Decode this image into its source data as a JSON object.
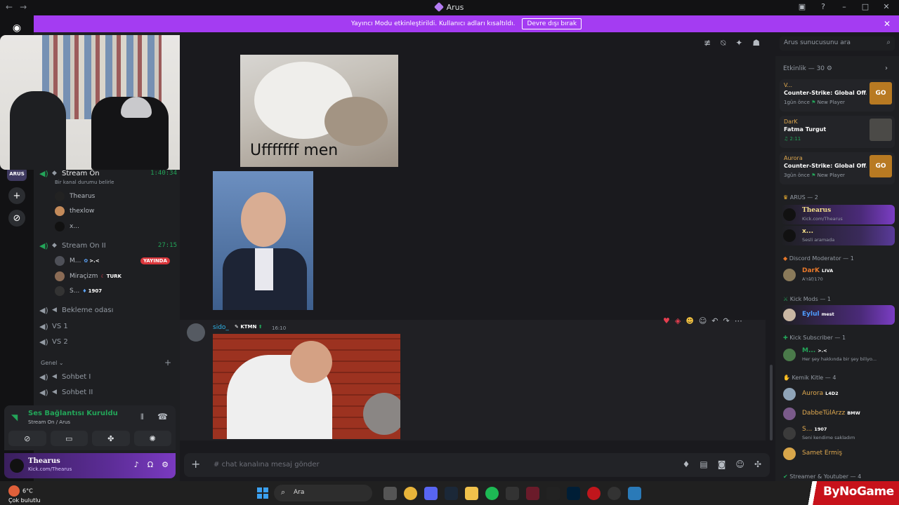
{
  "window": {
    "title": "Arus",
    "nav_back": "←",
    "nav_forward": "→"
  },
  "banner": {
    "text": "Yayıncı Modu etkinleştirildi. Kullanıcı adları kısaltıldı.",
    "button": "Devre dışı bırak",
    "close": "✕"
  },
  "guilds": {
    "arus_label": "ARUS",
    "add": "+",
    "explore": "⊘"
  },
  "channels": {
    "stream_on": {
      "name": "Stream On",
      "time": "1:40:34",
      "status": "Bir kanal durumu belirle"
    },
    "stream_on_members": [
      {
        "name": "Thearus",
        "tag": ""
      },
      {
        "name": "thexlow",
        "tag": ""
      },
      {
        "name": "x...",
        "tag": ""
      }
    ],
    "stream_on_ii": {
      "name": "Stream On II",
      "time": "27:15"
    },
    "stream_on_ii_members": [
      {
        "name": "M...",
        "tag": ">.<",
        "badge": "YAYINDA"
      },
      {
        "name": "Miraçizm",
        "tag": "TURK"
      },
      {
        "name": "S...",
        "tag": "1907"
      }
    ],
    "bekleme": "Bekleme odası",
    "vs1": "VS 1",
    "vs2": "VS 2",
    "category_genel": "Genel",
    "sohbet1": "Sohbet I",
    "sohbet2": "Sohbet II"
  },
  "voice_panel": {
    "status": "Ses Bağlantısı Kuruldu",
    "location": "Stream On / Arus"
  },
  "user_panel": {
    "name": "Thearus",
    "status": "Kick.com/Thearus"
  },
  "header": {
    "search_placeholder": "Arus sunucusunu ara"
  },
  "messages": {
    "gif_caption": "Ufffffff men",
    "author": "sido_",
    "author_role": "KTMN",
    "time": "16:10"
  },
  "composer": {
    "placeholder": "chat kanalına mesaj gönder",
    "channel_prefix": "#"
  },
  "activity": {
    "header": "Etkinlik — 30",
    "cards": [
      {
        "name": "V...",
        "game": "Counter-Strike: Global Off...",
        "meta": "1gün önce",
        "extra": "New Player",
        "thumb": "GO"
      },
      {
        "name": "DarK",
        "game": "Fatma Turgut",
        "meta": "2:11",
        "extra": "",
        "thumb": ""
      },
      {
        "name": "Aurora",
        "game": "Counter-Strike: Global Off...",
        "meta": "3gün önce",
        "extra": "New Player",
        "thumb": "GO"
      }
    ]
  },
  "members": {
    "arus_header": "ARUS — 2",
    "thearus": {
      "name": "Thearus",
      "status": "Kick.com/Thearus"
    },
    "x": {
      "name": "x...",
      "status": "Sesli aramada"
    },
    "mod_header": "Discord Moderator — 1",
    "dark": {
      "name": "DarK",
      "tag": "LIVA",
      "status": "A'râf/170"
    },
    "kickmods_header": "Kick Mods — 1",
    "eylul": {
      "name": "Eylul",
      "tag": "mest"
    },
    "kicksub_header": "Kick Subscriber — 1",
    "m": {
      "name": "M...",
      "tag": ">.<",
      "status": "Her şey hakkında bir şey biliyo..."
    },
    "kemik_header": "Kemik Kitle — 4",
    "aurora": {
      "name": "Aurora",
      "tag": "L4D2"
    },
    "dabbe": {
      "name": "DabbeTülArzz",
      "tag": "BMW"
    },
    "s": {
      "name": "S...",
      "tag": "1907",
      "status": "Seni kendime sakladım"
    },
    "samet": {
      "name": "Samet Ermiş"
    },
    "streamer_header": "Streamer & Youtuber — 4"
  },
  "taskbar": {
    "temp": "6°C",
    "weather": "Çok bulutlu",
    "search": "Ara",
    "watermark": "ByNoGame"
  },
  "colors": {
    "accent": "#a43cf2",
    "online": "#23a559",
    "live": "#da373c"
  }
}
